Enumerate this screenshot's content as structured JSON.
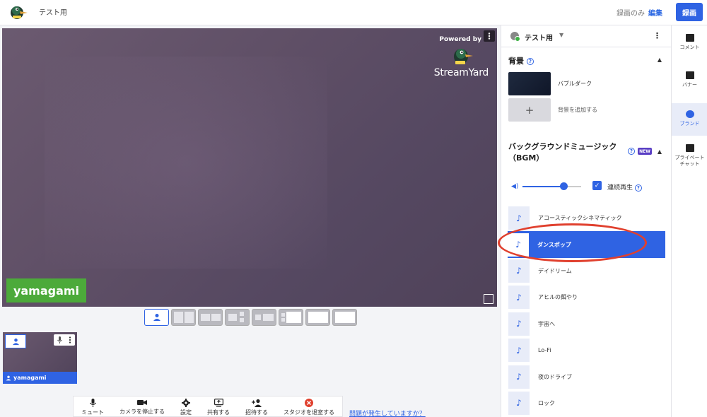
{
  "header": {
    "studio_title": "テスト用",
    "record_only": "録画のみ",
    "edit": "編集",
    "record_button": "録画"
  },
  "stage": {
    "powered_by": "Powered by",
    "brand_word": "StreamYard",
    "name_tag": "yamagami"
  },
  "preview": {
    "participant_name": "yamagami"
  },
  "toolbar": {
    "items": [
      {
        "label": "ミュート",
        "icon": "mic-icon"
      },
      {
        "label": "カメラを停止する",
        "icon": "camera-icon"
      },
      {
        "label": "設定",
        "icon": "gear-icon"
      },
      {
        "label": "共有する",
        "icon": "screen-share-icon"
      },
      {
        "label": "招待する",
        "icon": "add-person-icon"
      },
      {
        "label": "スタジオを退室する",
        "icon": "leave-icon"
      }
    ],
    "problem_link": "問題が発生していますか？"
  },
  "panel": {
    "brand_name": "テスト用",
    "background": {
      "title": "背景",
      "selected_name": "バブルダーク",
      "add_label": "背景を追加する"
    },
    "bgm": {
      "title_line1": "バックグラウンドミュージック",
      "title_line2": "（BGM）",
      "new_badge": "NEW",
      "volume_percent": 70,
      "loop_label": "連続再生",
      "tracks": [
        "アコースティックシネマティック",
        "ダンスポップ",
        "デイドリーム",
        "アヒルの餌やり",
        "宇宙へ",
        "Lo-Fi",
        "夜のドライブ",
        "ロック"
      ],
      "selected_index": 1
    }
  },
  "rail": {
    "items": [
      "コメント",
      "バナー",
      "ブランド",
      "プライベートチャット"
    ],
    "active": "ブランド"
  },
  "colors": {
    "accent": "#2f63e3",
    "name_tag_green": "#4caa3a",
    "highlight_red": "#e0402e"
  }
}
